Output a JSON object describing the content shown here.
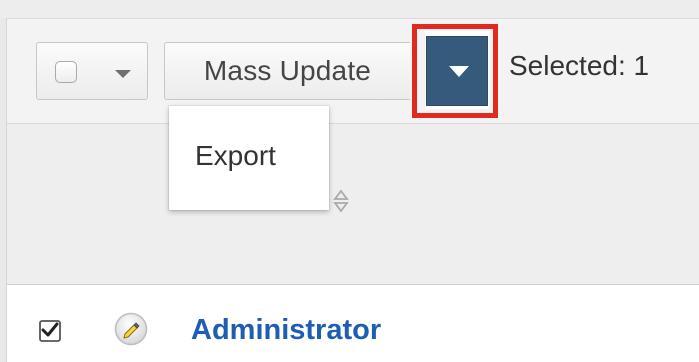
{
  "toolbar": {
    "mass_update_label": "Mass Update",
    "selected_label": "Selected: 1"
  },
  "menu": {
    "export_label": "Export"
  },
  "row": {
    "record_name": "Administrator",
    "checked": true
  },
  "icons": {
    "select_all_checkbox": "checkbox-icon",
    "select_all_caret": "caret-down-icon",
    "mass_update_caret": "caret-down-icon",
    "sort": "sort-icon",
    "edit": "edit-icon",
    "row_checkbox": "checked-checkbox-icon"
  },
  "colors": {
    "dropdown_toggle": "#365a7c",
    "highlight": "#e0291f",
    "link": "#1d5db4"
  }
}
